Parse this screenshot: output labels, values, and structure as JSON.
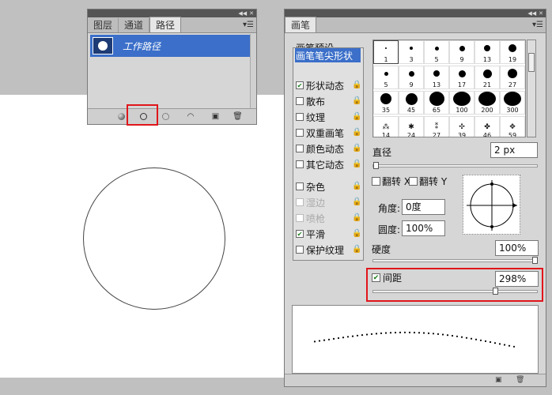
{
  "paths_panel": {
    "tabs": [
      "图层",
      "通道",
      "路径"
    ],
    "active_tab": 2,
    "path_name": "工作路径",
    "footer_icons": [
      "fill-path-icon",
      "stroke-path-icon",
      "load-selection-icon",
      "make-work-path-icon",
      "new-path-icon",
      "delete-path-icon"
    ]
  },
  "brush_panel": {
    "tab": "画笔",
    "presets_button": "画笔预设",
    "options": [
      {
        "label": "画笔笔尖形状",
        "checkbox": false,
        "selected": true,
        "disabled": false,
        "lock": false
      },
      {
        "label": "形状动态",
        "checkbox": true,
        "checked": true,
        "disabled": false,
        "lock": true
      },
      {
        "label": "散布",
        "checkbox": true,
        "checked": false,
        "disabled": false,
        "lock": true
      },
      {
        "label": "纹理",
        "checkbox": true,
        "checked": false,
        "disabled": false,
        "lock": true
      },
      {
        "label": "双重画笔",
        "checkbox": true,
        "checked": false,
        "disabled": false,
        "lock": true
      },
      {
        "label": "颜色动态",
        "checkbox": true,
        "checked": false,
        "disabled": false,
        "lock": true
      },
      {
        "label": "其它动态",
        "checkbox": true,
        "checked": false,
        "disabled": false,
        "lock": true
      },
      {
        "label": "杂色",
        "checkbox": true,
        "checked": false,
        "disabled": false,
        "lock": true
      },
      {
        "label": "湿边",
        "checkbox": true,
        "checked": false,
        "disabled": true,
        "lock": true
      },
      {
        "label": "喷枪",
        "checkbox": true,
        "checked": false,
        "disabled": true,
        "lock": true
      },
      {
        "label": "平滑",
        "checkbox": true,
        "checked": true,
        "disabled": false,
        "lock": true
      },
      {
        "label": "保护纹理",
        "checkbox": true,
        "checked": false,
        "disabled": false,
        "lock": true
      }
    ],
    "brush_sizes": [
      1,
      3,
      5,
      9,
      13,
      19,
      5,
      9,
      13,
      17,
      21,
      27,
      35,
      45,
      65,
      100,
      200,
      300,
      14,
      24,
      27,
      39,
      46,
      59
    ],
    "diameter_label": "直径",
    "diameter_value": "2 px",
    "flip_x_label": "翻转 X",
    "flip_y_label": "翻转 Y",
    "angle_label": "角度:",
    "angle_value": "0度",
    "roundness_label": "圆度:",
    "roundness_value": "100%",
    "hardness_label": "硬度",
    "hardness_value": "100%",
    "hardness_fraction": 1.0,
    "spacing_label": "间距",
    "spacing_checked": true,
    "spacing_value": "298%",
    "spacing_fraction": 0.75,
    "diameter_fraction": 0.0
  }
}
